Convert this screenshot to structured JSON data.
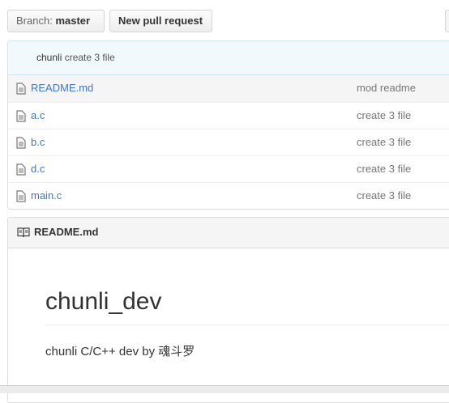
{
  "toolbar": {
    "branch_prefix": "Branch:",
    "branch_name": "master",
    "new_pr_label": "New pull request"
  },
  "commit": {
    "author": "chunli",
    "message": "create 3 file"
  },
  "files": [
    {
      "name": "README.md",
      "commit": "mod readme"
    },
    {
      "name": "a.c",
      "commit": "create 3 file"
    },
    {
      "name": "b.c",
      "commit": "create 3 file"
    },
    {
      "name": "d.c",
      "commit": "create 3 file"
    },
    {
      "name": "main.c",
      "commit": "create 3 file"
    }
  ],
  "readme": {
    "title": "README.md",
    "heading": "chunli_dev",
    "text": "chunli C/C++ dev by 魂斗罗"
  },
  "colors": {
    "link": "#4078c0",
    "commit_bar_bg": "#f2f9fc"
  },
  "icons": {
    "file": "file-icon",
    "readme": "book-icon",
    "caret": "caret-down-icon"
  }
}
